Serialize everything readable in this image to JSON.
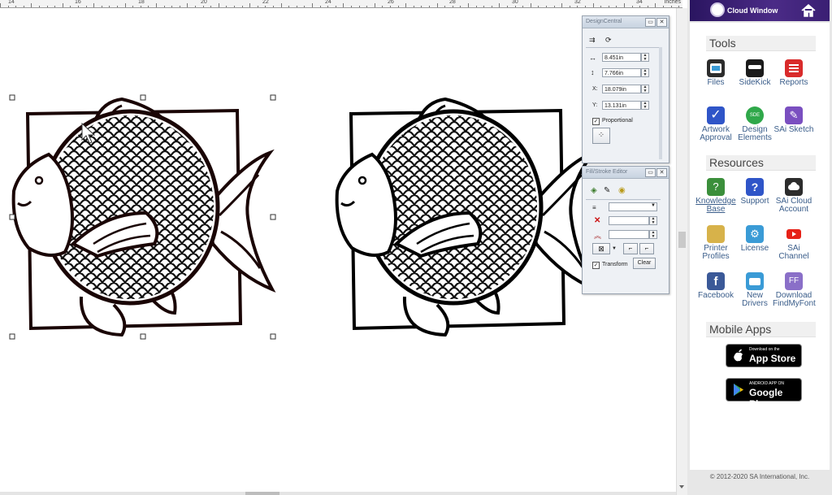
{
  "ruler": {
    "numbers": [
      "14",
      "16",
      "18",
      "20",
      "22",
      "24",
      "26",
      "28",
      "30",
      "32",
      "34"
    ],
    "units": "inches"
  },
  "design_central": {
    "title": "DesignCentral",
    "width": "8.451in",
    "height": "7.766in",
    "x_label": "X:",
    "x": "18.079in",
    "y_label": "Y:",
    "y": "13.131in",
    "proportional_label": "Proportional"
  },
  "fill_stroke": {
    "title": "Fill/Stroke Editor",
    "transform_label": "Transform",
    "clear_label": "Clear"
  },
  "cloud": {
    "title": "Cloud Window",
    "tools_heading": "Tools",
    "tools": [
      {
        "label": "Files",
        "icon": "files-icon",
        "color": "#2c2c2c"
      },
      {
        "label": "SideKick",
        "icon": "sidekick-icon",
        "color": "#1b1b1b"
      },
      {
        "label": "Reports",
        "icon": "reports-icon",
        "color": "#d92b2b"
      },
      {
        "label": "Artwork Approval",
        "icon": "approval-icon",
        "color": "#2f55c8"
      },
      {
        "label": "Design Elements",
        "icon": "design-elements-icon",
        "color": "#2fa84a"
      },
      {
        "label": "SAi Sketch",
        "icon": "sketch-icon",
        "color": "#7a4fc0"
      }
    ],
    "resources_heading": "Resources",
    "resources": [
      {
        "label": "Knowledge Base",
        "icon": "knowledge-icon",
        "color": "#3b8f3b"
      },
      {
        "label": "Support",
        "icon": "support-icon",
        "color": "#2f55c8"
      },
      {
        "label": "SAi Cloud Account",
        "icon": "cloud-account-icon",
        "color": "#2c2c2c"
      },
      {
        "label": "Printer Profiles",
        "icon": "printer-profiles-icon",
        "color": "#d7b24a"
      },
      {
        "label": "License",
        "icon": "license-icon",
        "color": "#3a9bd6"
      },
      {
        "label": "SAi Channel",
        "icon": "youtube-icon",
        "color": "#e62117"
      },
      {
        "label": "Facebook",
        "icon": "facebook-icon",
        "color": "#3b5998"
      },
      {
        "label": "New Drivers",
        "icon": "drivers-icon",
        "color": "#3a9bd6"
      },
      {
        "label": "Download FindMyFont",
        "icon": "findmyfont-icon",
        "color": "#8a6fc8"
      }
    ],
    "mobile_heading": "Mobile Apps",
    "appstore_small": "Download on the",
    "appstore_big": "App Store",
    "googleplay_small": "ANDROID APP ON",
    "googleplay_big": "Google Play",
    "footer": "© 2012-2020 SA International, Inc."
  }
}
